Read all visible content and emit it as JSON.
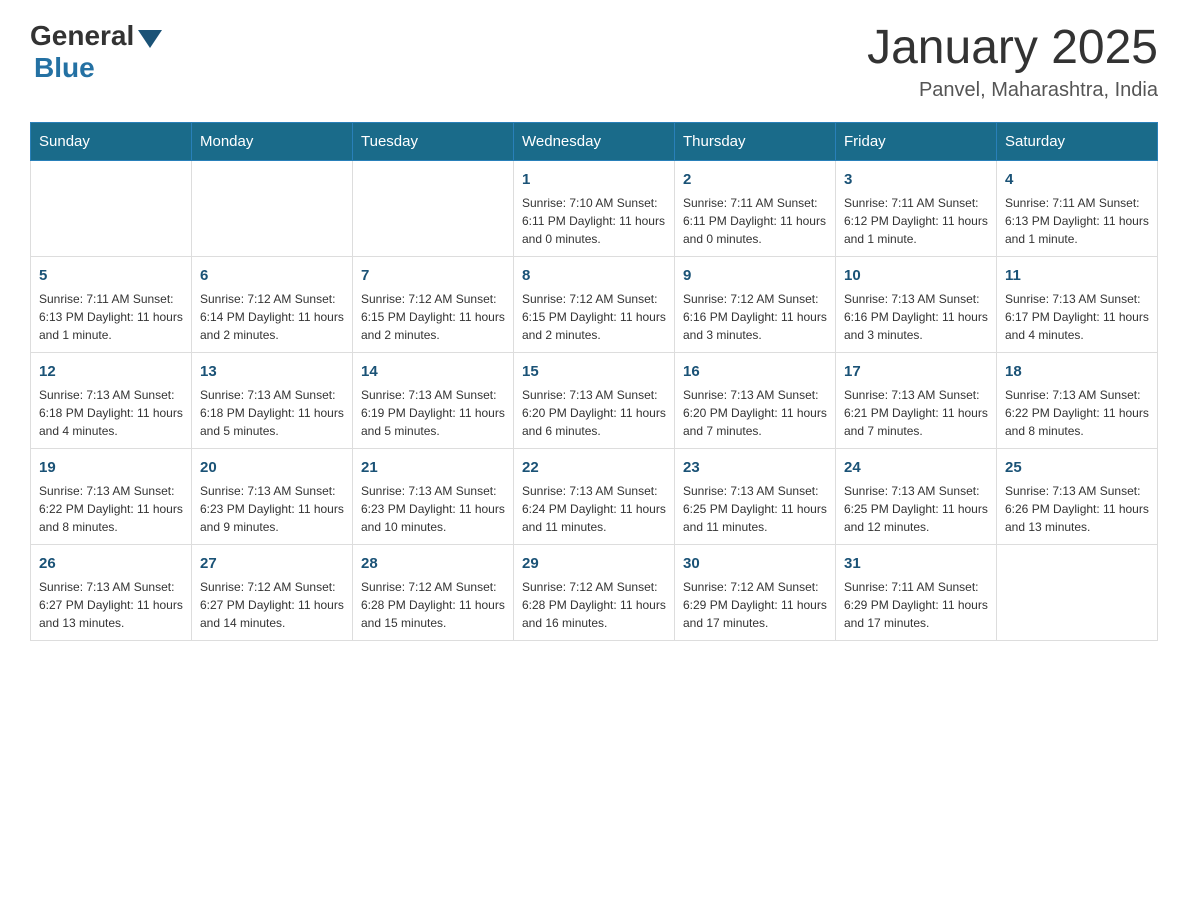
{
  "header": {
    "logo_general": "General",
    "logo_blue": "Blue",
    "month_year": "January 2025",
    "location": "Panvel, Maharashtra, India"
  },
  "days_of_week": [
    "Sunday",
    "Monday",
    "Tuesday",
    "Wednesday",
    "Thursday",
    "Friday",
    "Saturday"
  ],
  "weeks": [
    [
      {
        "day": "",
        "info": ""
      },
      {
        "day": "",
        "info": ""
      },
      {
        "day": "",
        "info": ""
      },
      {
        "day": "1",
        "info": "Sunrise: 7:10 AM\nSunset: 6:11 PM\nDaylight: 11 hours and 0 minutes."
      },
      {
        "day": "2",
        "info": "Sunrise: 7:11 AM\nSunset: 6:11 PM\nDaylight: 11 hours and 0 minutes."
      },
      {
        "day": "3",
        "info": "Sunrise: 7:11 AM\nSunset: 6:12 PM\nDaylight: 11 hours and 1 minute."
      },
      {
        "day": "4",
        "info": "Sunrise: 7:11 AM\nSunset: 6:13 PM\nDaylight: 11 hours and 1 minute."
      }
    ],
    [
      {
        "day": "5",
        "info": "Sunrise: 7:11 AM\nSunset: 6:13 PM\nDaylight: 11 hours and 1 minute."
      },
      {
        "day": "6",
        "info": "Sunrise: 7:12 AM\nSunset: 6:14 PM\nDaylight: 11 hours and 2 minutes."
      },
      {
        "day": "7",
        "info": "Sunrise: 7:12 AM\nSunset: 6:15 PM\nDaylight: 11 hours and 2 minutes."
      },
      {
        "day": "8",
        "info": "Sunrise: 7:12 AM\nSunset: 6:15 PM\nDaylight: 11 hours and 2 minutes."
      },
      {
        "day": "9",
        "info": "Sunrise: 7:12 AM\nSunset: 6:16 PM\nDaylight: 11 hours and 3 minutes."
      },
      {
        "day": "10",
        "info": "Sunrise: 7:13 AM\nSunset: 6:16 PM\nDaylight: 11 hours and 3 minutes."
      },
      {
        "day": "11",
        "info": "Sunrise: 7:13 AM\nSunset: 6:17 PM\nDaylight: 11 hours and 4 minutes."
      }
    ],
    [
      {
        "day": "12",
        "info": "Sunrise: 7:13 AM\nSunset: 6:18 PM\nDaylight: 11 hours and 4 minutes."
      },
      {
        "day": "13",
        "info": "Sunrise: 7:13 AM\nSunset: 6:18 PM\nDaylight: 11 hours and 5 minutes."
      },
      {
        "day": "14",
        "info": "Sunrise: 7:13 AM\nSunset: 6:19 PM\nDaylight: 11 hours and 5 minutes."
      },
      {
        "day": "15",
        "info": "Sunrise: 7:13 AM\nSunset: 6:20 PM\nDaylight: 11 hours and 6 minutes."
      },
      {
        "day": "16",
        "info": "Sunrise: 7:13 AM\nSunset: 6:20 PM\nDaylight: 11 hours and 7 minutes."
      },
      {
        "day": "17",
        "info": "Sunrise: 7:13 AM\nSunset: 6:21 PM\nDaylight: 11 hours and 7 minutes."
      },
      {
        "day": "18",
        "info": "Sunrise: 7:13 AM\nSunset: 6:22 PM\nDaylight: 11 hours and 8 minutes."
      }
    ],
    [
      {
        "day": "19",
        "info": "Sunrise: 7:13 AM\nSunset: 6:22 PM\nDaylight: 11 hours and 8 minutes."
      },
      {
        "day": "20",
        "info": "Sunrise: 7:13 AM\nSunset: 6:23 PM\nDaylight: 11 hours and 9 minutes."
      },
      {
        "day": "21",
        "info": "Sunrise: 7:13 AM\nSunset: 6:23 PM\nDaylight: 11 hours and 10 minutes."
      },
      {
        "day": "22",
        "info": "Sunrise: 7:13 AM\nSunset: 6:24 PM\nDaylight: 11 hours and 11 minutes."
      },
      {
        "day": "23",
        "info": "Sunrise: 7:13 AM\nSunset: 6:25 PM\nDaylight: 11 hours and 11 minutes."
      },
      {
        "day": "24",
        "info": "Sunrise: 7:13 AM\nSunset: 6:25 PM\nDaylight: 11 hours and 12 minutes."
      },
      {
        "day": "25",
        "info": "Sunrise: 7:13 AM\nSunset: 6:26 PM\nDaylight: 11 hours and 13 minutes."
      }
    ],
    [
      {
        "day": "26",
        "info": "Sunrise: 7:13 AM\nSunset: 6:27 PM\nDaylight: 11 hours and 13 minutes."
      },
      {
        "day": "27",
        "info": "Sunrise: 7:12 AM\nSunset: 6:27 PM\nDaylight: 11 hours and 14 minutes."
      },
      {
        "day": "28",
        "info": "Sunrise: 7:12 AM\nSunset: 6:28 PM\nDaylight: 11 hours and 15 minutes."
      },
      {
        "day": "29",
        "info": "Sunrise: 7:12 AM\nSunset: 6:28 PM\nDaylight: 11 hours and 16 minutes."
      },
      {
        "day": "30",
        "info": "Sunrise: 7:12 AM\nSunset: 6:29 PM\nDaylight: 11 hours and 17 minutes."
      },
      {
        "day": "31",
        "info": "Sunrise: 7:11 AM\nSunset: 6:29 PM\nDaylight: 11 hours and 17 minutes."
      },
      {
        "day": "",
        "info": ""
      }
    ]
  ]
}
